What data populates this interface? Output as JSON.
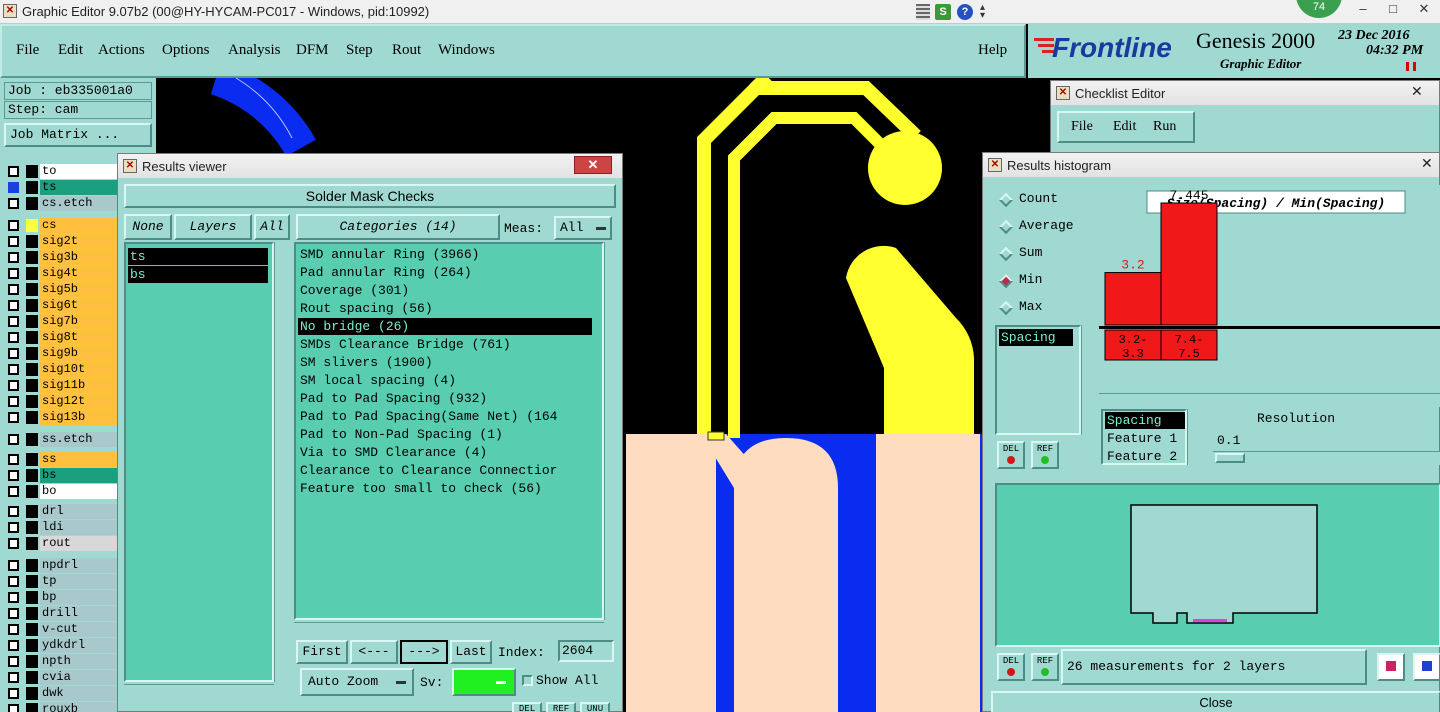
{
  "window": {
    "title": "Graphic Editor 9.07b2 (00@HY-HYCAM-PC017 - Windows, pid:10992)",
    "badge": "74",
    "controls": [
      "–",
      "□",
      "✕"
    ]
  },
  "menu": {
    "items": [
      "File",
      "Edit",
      "Actions",
      "Options",
      "Analysis",
      "DFM",
      "Step",
      "Rout",
      "Windows"
    ],
    "help": "Help"
  },
  "brand": {
    "logo": "Frontline",
    "product": "Genesis 2000",
    "subtitle": "Graphic Editor",
    "date": "23 Dec 2016",
    "time": "04:32 PM"
  },
  "job": {
    "job_label": "Job : eb335001a0",
    "step_label": "Step: cam",
    "matrix_button": "Job Matrix ..."
  },
  "layers": [
    {
      "name": "to",
      "color": "#ffffff"
    },
    {
      "name": "ts",
      "color": "#1aa07e",
      "active": true
    },
    {
      "name": "cs.etch",
      "color": "#a8c8cc"
    },
    {
      "name": "cs",
      "color": "#ffc040",
      "swatch": "#ffff40"
    },
    {
      "name": "sig2t",
      "color": "#ffc040"
    },
    {
      "name": "sig3b",
      "color": "#ffc040"
    },
    {
      "name": "sig4t",
      "color": "#ffc040"
    },
    {
      "name": "sig5b",
      "color": "#ffc040"
    },
    {
      "name": "sig6t",
      "color": "#ffc040"
    },
    {
      "name": "sig7b",
      "color": "#ffc040"
    },
    {
      "name": "sig8t",
      "color": "#ffc040"
    },
    {
      "name": "sig9b",
      "color": "#ffc040"
    },
    {
      "name": "sig10t",
      "color": "#ffc040"
    },
    {
      "name": "sig11b",
      "color": "#ffc040"
    },
    {
      "name": "sig12t",
      "color": "#ffc040"
    },
    {
      "name": "sig13b",
      "color": "#ffc040"
    },
    {
      "name": "ss.etch",
      "color": "#a8c8cc"
    },
    {
      "name": "ss",
      "color": "#ffc040"
    },
    {
      "name": "bs",
      "color": "#1aa07e"
    },
    {
      "name": "bo",
      "color": "#ffffff"
    },
    {
      "name": "drl",
      "color": "#a8c8cc"
    },
    {
      "name": "ldi",
      "color": "#a8c8cc"
    },
    {
      "name": "rout",
      "color": "#d8d8d8"
    },
    {
      "name": "npdrl",
      "color": "#a8c8cc"
    },
    {
      "name": "tp",
      "color": "#a8c8cc"
    },
    {
      "name": "bp",
      "color": "#a8c8cc"
    },
    {
      "name": "drill",
      "color": "#a8c8cc"
    },
    {
      "name": "v-cut",
      "color": "#a8c8cc"
    },
    {
      "name": "ydkdrl",
      "color": "#a8c8cc"
    },
    {
      "name": "npth",
      "color": "#a8c8cc"
    },
    {
      "name": "cvia",
      "color": "#a8c8cc"
    },
    {
      "name": "dwk",
      "color": "#a8c8cc"
    },
    {
      "name": "rouxb",
      "color": "#a8c8cc"
    }
  ],
  "results_viewer": {
    "title": "Results viewer",
    "header": "Solder Mask Checks",
    "none_btn": "None",
    "layers_btn": "Layers",
    "all_btn": "All",
    "categories_btn": "Categories (14)",
    "meas_label": "Meas:",
    "meas_value": "All",
    "layers": [
      "ts",
      "bs"
    ],
    "categories": [
      "SMD annular Ring (3966)",
      "Pad annular Ring (264)",
      "Coverage (301)",
      "Rout spacing (56)",
      "No bridge (26)",
      "SMDs Clearance Bridge (761)",
      "SM slivers (1900)",
      "SM local spacing (4)",
      "Pad to Pad Spacing (932)",
      "Pad to Pad Spacing(Same Net) (164",
      "Pad to Non-Pad Spacing (1)",
      "Via to SMD Clearance (4)",
      "Clearance to Clearance Connectior",
      "Feature too small to check (56)"
    ],
    "selected_category_index": 4,
    "first_btn": "First",
    "prev_btn": "<---",
    "next_btn": "--->",
    "last_btn": "Last",
    "index_label": "Index:",
    "index_value": "2604",
    "zoom_btn": "Auto Zoom",
    "sv_label": "Sv:",
    "show_all": "Show All",
    "bottom_btns": [
      "DEL",
      "REF",
      "UNU"
    ]
  },
  "checklist": {
    "title": "Checklist Editor",
    "menu": [
      "File",
      "Edit",
      "Run"
    ]
  },
  "histogram": {
    "title": "Results histogram",
    "modes": [
      "Count",
      "Average",
      "Sum",
      "Min",
      "Max"
    ],
    "selected_mode": "Min",
    "measure_list": [
      "Spacing"
    ],
    "chart_title": "Size(Spacing) / Min(Spacing)",
    "attr_list": [
      "Spacing",
      "Feature 1",
      "Feature 2"
    ],
    "resolution_label": "Resolution",
    "resolution_value": "0.1",
    "summary": "26 measurements for 2 layers",
    "close": "Close",
    "del": "DEL",
    "ref": "REF"
  },
  "chart_data": {
    "type": "bar",
    "title": "Size(Spacing) / Min(Spacing)",
    "categories": [
      "3.2-\n3.3",
      "7.4-\n7.5"
    ],
    "bin_labels_top": [
      "3.2-",
      "7.4-"
    ],
    "bin_labels_bottom": [
      "3.3",
      "7.5"
    ],
    "values": [
      3.2,
      7.445
    ],
    "value_labels": [
      "3.2",
      "7.445"
    ],
    "bar_color": "#f01818"
  }
}
